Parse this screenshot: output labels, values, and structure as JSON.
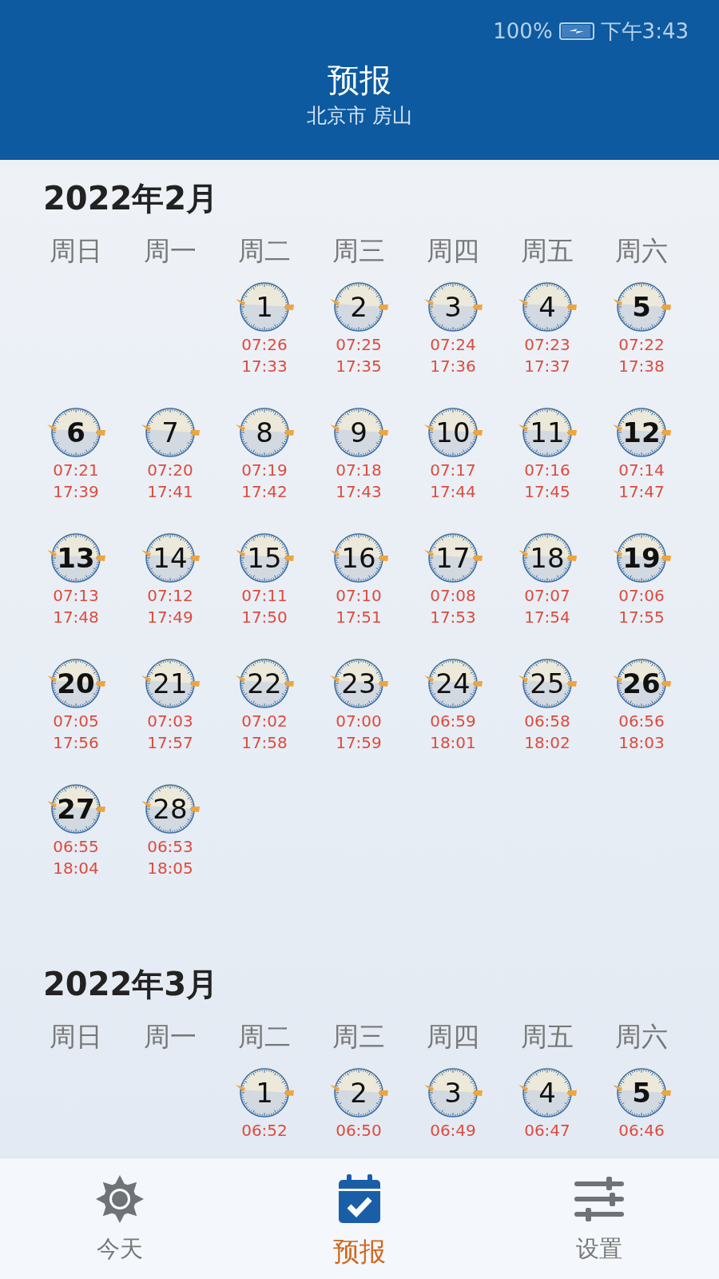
{
  "status_bar": {
    "battery": "100%",
    "time": "下午3:43"
  },
  "header": {
    "title": "预报",
    "location": "北京市 房山"
  },
  "months": [
    {
      "title": "2022年2月",
      "weekdays": [
        "周日",
        "周一",
        "周二",
        "周三",
        "周四",
        "周五",
        "周六"
      ],
      "days": [
        {
          "kind": "empty"
        },
        {
          "kind": "empty"
        },
        {
          "kind": "day",
          "day": "1",
          "weekend": false,
          "sunrise": "07:26",
          "sunset": "17:33"
        },
        {
          "kind": "day",
          "day": "2",
          "weekend": false,
          "sunrise": "07:25",
          "sunset": "17:35"
        },
        {
          "kind": "day",
          "day": "3",
          "weekend": false,
          "sunrise": "07:24",
          "sunset": "17:36"
        },
        {
          "kind": "day",
          "day": "4",
          "weekend": false,
          "sunrise": "07:23",
          "sunset": "17:37"
        },
        {
          "kind": "day",
          "day": "5",
          "weekend": true,
          "sunrise": "07:22",
          "sunset": "17:38"
        },
        {
          "kind": "day",
          "day": "6",
          "weekend": true,
          "sunrise": "07:21",
          "sunset": "17:39"
        },
        {
          "kind": "day",
          "day": "7",
          "weekend": false,
          "sunrise": "07:20",
          "sunset": "17:41"
        },
        {
          "kind": "day",
          "day": "8",
          "weekend": false,
          "sunrise": "07:19",
          "sunset": "17:42"
        },
        {
          "kind": "day",
          "day": "9",
          "weekend": false,
          "sunrise": "07:18",
          "sunset": "17:43"
        },
        {
          "kind": "day",
          "day": "10",
          "weekend": false,
          "sunrise": "07:17",
          "sunset": "17:44"
        },
        {
          "kind": "day",
          "day": "11",
          "weekend": false,
          "sunrise": "07:16",
          "sunset": "17:45"
        },
        {
          "kind": "day",
          "day": "12",
          "weekend": true,
          "sunrise": "07:14",
          "sunset": "17:47"
        },
        {
          "kind": "day",
          "day": "13",
          "weekend": true,
          "sunrise": "07:13",
          "sunset": "17:48"
        },
        {
          "kind": "day",
          "day": "14",
          "weekend": false,
          "sunrise": "07:12",
          "sunset": "17:49"
        },
        {
          "kind": "day",
          "day": "15",
          "weekend": false,
          "sunrise": "07:11",
          "sunset": "17:50"
        },
        {
          "kind": "day",
          "day": "16",
          "weekend": false,
          "sunrise": "07:10",
          "sunset": "17:51"
        },
        {
          "kind": "day",
          "day": "17",
          "weekend": false,
          "sunrise": "07:08",
          "sunset": "17:53"
        },
        {
          "kind": "day",
          "day": "18",
          "weekend": false,
          "sunrise": "07:07",
          "sunset": "17:54"
        },
        {
          "kind": "day",
          "day": "19",
          "weekend": true,
          "sunrise": "07:06",
          "sunset": "17:55"
        },
        {
          "kind": "day",
          "day": "20",
          "weekend": true,
          "sunrise": "07:05",
          "sunset": "17:56"
        },
        {
          "kind": "day",
          "day": "21",
          "weekend": false,
          "sunrise": "07:03",
          "sunset": "17:57"
        },
        {
          "kind": "day",
          "day": "22",
          "weekend": false,
          "sunrise": "07:02",
          "sunset": "17:58"
        },
        {
          "kind": "day",
          "day": "23",
          "weekend": false,
          "sunrise": "07:00",
          "sunset": "17:59"
        },
        {
          "kind": "day",
          "day": "24",
          "weekend": false,
          "sunrise": "06:59",
          "sunset": "18:01"
        },
        {
          "kind": "day",
          "day": "25",
          "weekend": false,
          "sunrise": "06:58",
          "sunset": "18:02"
        },
        {
          "kind": "day",
          "day": "26",
          "weekend": true,
          "sunrise": "06:56",
          "sunset": "18:03"
        },
        {
          "kind": "day",
          "day": "27",
          "weekend": true,
          "sunrise": "06:55",
          "sunset": "18:04"
        },
        {
          "kind": "day",
          "day": "28",
          "weekend": false,
          "sunrise": "06:53",
          "sunset": "18:05"
        }
      ]
    },
    {
      "title": "2022年3月",
      "weekdays": [
        "周日",
        "周一",
        "周二",
        "周三",
        "周四",
        "周五",
        "周六"
      ],
      "days": [
        {
          "kind": "empty"
        },
        {
          "kind": "empty"
        },
        {
          "kind": "day",
          "day": "1",
          "weekend": false,
          "sunrise": "06:52"
        },
        {
          "kind": "day",
          "day": "2",
          "weekend": false,
          "sunrise": "06:50"
        },
        {
          "kind": "day",
          "day": "3",
          "weekend": false,
          "sunrise": "06:49"
        },
        {
          "kind": "day",
          "day": "4",
          "weekend": false,
          "sunrise": "06:47"
        },
        {
          "kind": "day",
          "day": "5",
          "weekend": true,
          "sunrise": "06:46"
        }
      ]
    }
  ],
  "tabs": [
    {
      "label": "今天",
      "kind": "sun",
      "selected": false
    },
    {
      "label": "预报",
      "kind": "calendar",
      "selected": true
    },
    {
      "label": "设置",
      "kind": "sliders",
      "selected": false
    }
  ]
}
